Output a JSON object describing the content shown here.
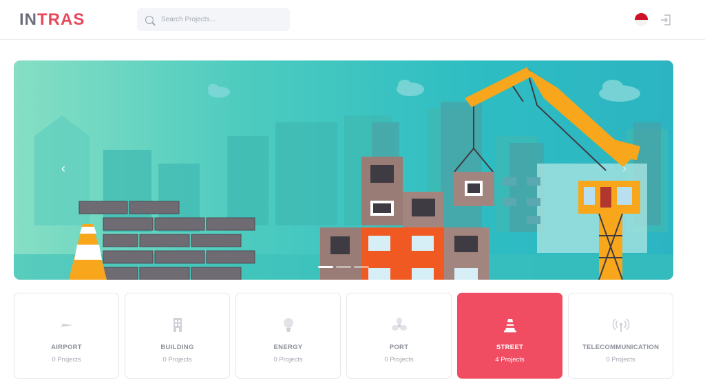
{
  "header": {
    "logo_text_a": "IN",
    "logo_text_b": "TRAS",
    "search_placeholder": "Search Projects...",
    "language_flag": "indonesia-flag-icon",
    "logout_icon": "logout-icon"
  },
  "banner": {
    "prev_icon": "chevron-left-icon",
    "next_icon": "chevron-right-icon",
    "slides": 3,
    "active_slide": 1
  },
  "categories": [
    {
      "title": "AIRPORT",
      "count": "0 Projects",
      "icon": "plane-icon",
      "active": false
    },
    {
      "title": "BUILDING",
      "count": "0 Projects",
      "icon": "building-icon",
      "active": false
    },
    {
      "title": "ENERGY",
      "count": "0 Projects",
      "icon": "lightbulb-icon",
      "active": false
    },
    {
      "title": "PORT",
      "count": "0 Projects",
      "icon": "propeller-icon",
      "active": false
    },
    {
      "title": "STREET",
      "count": "4 Projects",
      "icon": "traffic-cone-icon",
      "active": true
    },
    {
      "title": "TELECOMMUNICATION",
      "count": "0 Projects",
      "icon": "antenna-icon",
      "active": false
    }
  ],
  "colors": {
    "accent": "#f04d63",
    "banner_teal": "#2cb4c2",
    "crane": "#f8a61c"
  }
}
